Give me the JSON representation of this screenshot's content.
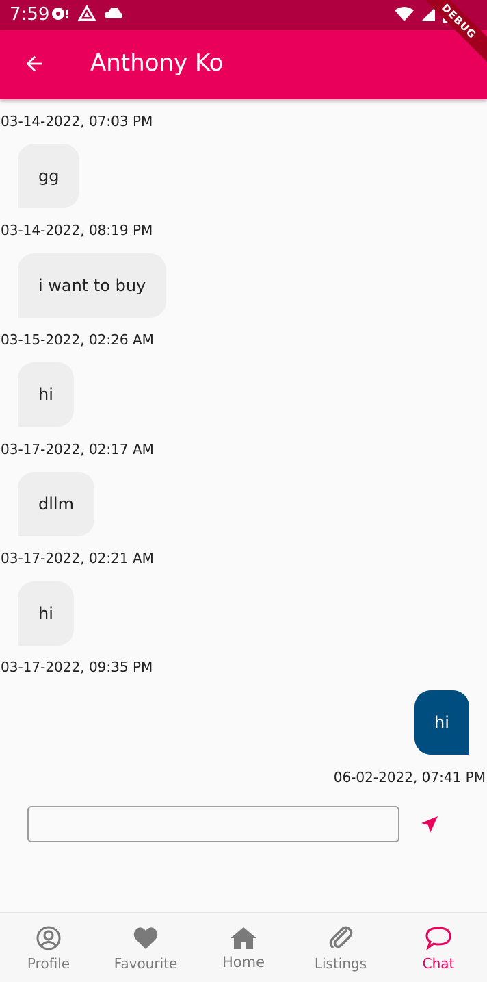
{
  "status_bar": {
    "time": "7:59",
    "debug_banner": "DEBUG",
    "icons": [
      "notification-icon",
      "drive-icon",
      "cloud-icon",
      "wifi-icon",
      "signal-icon",
      "battery-icon"
    ]
  },
  "app_bar": {
    "title": "Anthony Ko",
    "back_icon": "arrow-back-icon"
  },
  "messages": [
    {
      "timestamp": "03-14-2022, 07:03 PM",
      "text": "gg",
      "direction": "incoming"
    },
    {
      "timestamp": "03-14-2022, 08:19 PM",
      "text": "i want to buy",
      "direction": "incoming"
    },
    {
      "timestamp": "03-15-2022, 02:26 AM",
      "text": "hi",
      "direction": "incoming"
    },
    {
      "timestamp": "03-17-2022, 02:17 AM",
      "text": "dllm",
      "direction": "incoming"
    },
    {
      "timestamp": "03-17-2022, 02:21 AM",
      "text": "hi",
      "direction": "incoming"
    },
    {
      "timestamp": "03-17-2022, 09:35 PM",
      "text": "",
      "direction": ""
    },
    {
      "timestamp": "06-02-2022, 07:41 PM",
      "text": "hi",
      "direction": "outgoing"
    }
  ],
  "composer": {
    "value": "",
    "placeholder": "",
    "send_icon": "send-icon"
  },
  "bottom_nav": {
    "items": [
      {
        "label": "Profile",
        "icon": "account-circle-icon",
        "active": false
      },
      {
        "label": "Favourite",
        "icon": "heart-icon",
        "active": false
      },
      {
        "label": "Home",
        "icon": "home-icon",
        "active": false
      },
      {
        "label": "Listings",
        "icon": "paperclip-icon",
        "active": false
      },
      {
        "label": "Chat",
        "icon": "chat-bubble-icon",
        "active": true
      }
    ]
  },
  "colors": {
    "status_bar": "#b0003f",
    "app_bar": "#e8005a",
    "incoming_bubble": "#eeeeee",
    "outgoing_bubble": "#004d80",
    "accent": "#e8005a"
  }
}
